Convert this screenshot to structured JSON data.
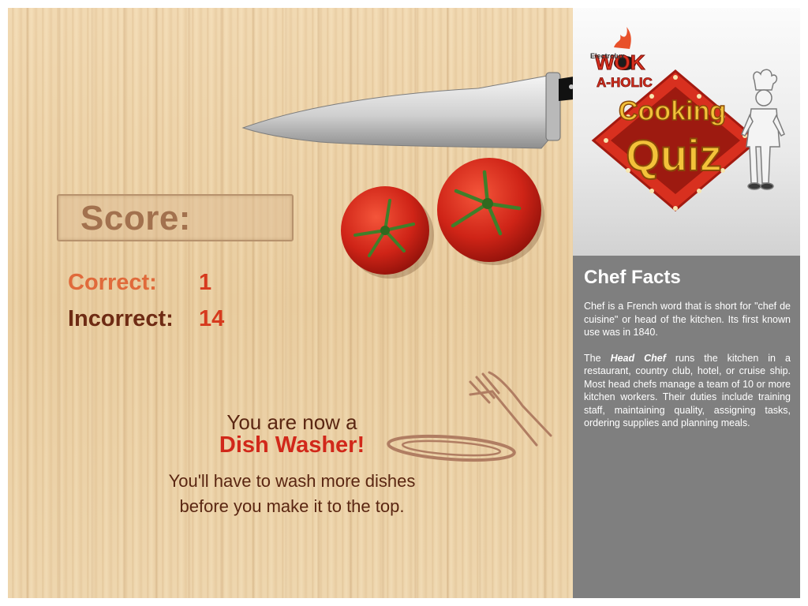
{
  "score": {
    "label": "Score:",
    "correct_label": "Correct:",
    "correct_value": "1",
    "incorrect_label": "Incorrect:",
    "incorrect_value": "14"
  },
  "result": {
    "line1": "You are now a",
    "rank": "Dish Washer!",
    "line3": "You'll have to wash more dishes",
    "line4": "before you make it to the top."
  },
  "logo": {
    "brand": "Electrolux",
    "wok_line1": "WOK",
    "wok_line2": "A-HOLIC",
    "title_line1": "Cooking",
    "title_line2": "Quiz"
  },
  "facts": {
    "title": "Chef Facts",
    "paragraph1": "Chef is a French word that is short for \"chef de cuisine\" or head of the kitchen. Its first known use was in 1840.",
    "p2_prefix": "The ",
    "p2_emphasis": "Head Chef",
    "p2_rest": " runs the kitchen in a restaurant, country club, hotel, or cruise ship. Most head chefs manage a team of 10 or more kitchen workers. Their duties include training staff, maintaining quality, assigning tasks, ordering supplies and planning meals."
  },
  "colors": {
    "board": "#ecd2a8",
    "score_label": "#a2714e",
    "correct": "#e06a3b",
    "incorrect": "#6e2b14",
    "value": "#d63a1e",
    "rank": "#d1281a",
    "facts_bg": "#7f7f7f",
    "logo_red": "#d8301f",
    "logo_gold": "#f3c23a"
  },
  "icons": [
    "knife-icon",
    "tomato-icon",
    "plate-icon",
    "fork-icon",
    "chef-icon"
  ]
}
